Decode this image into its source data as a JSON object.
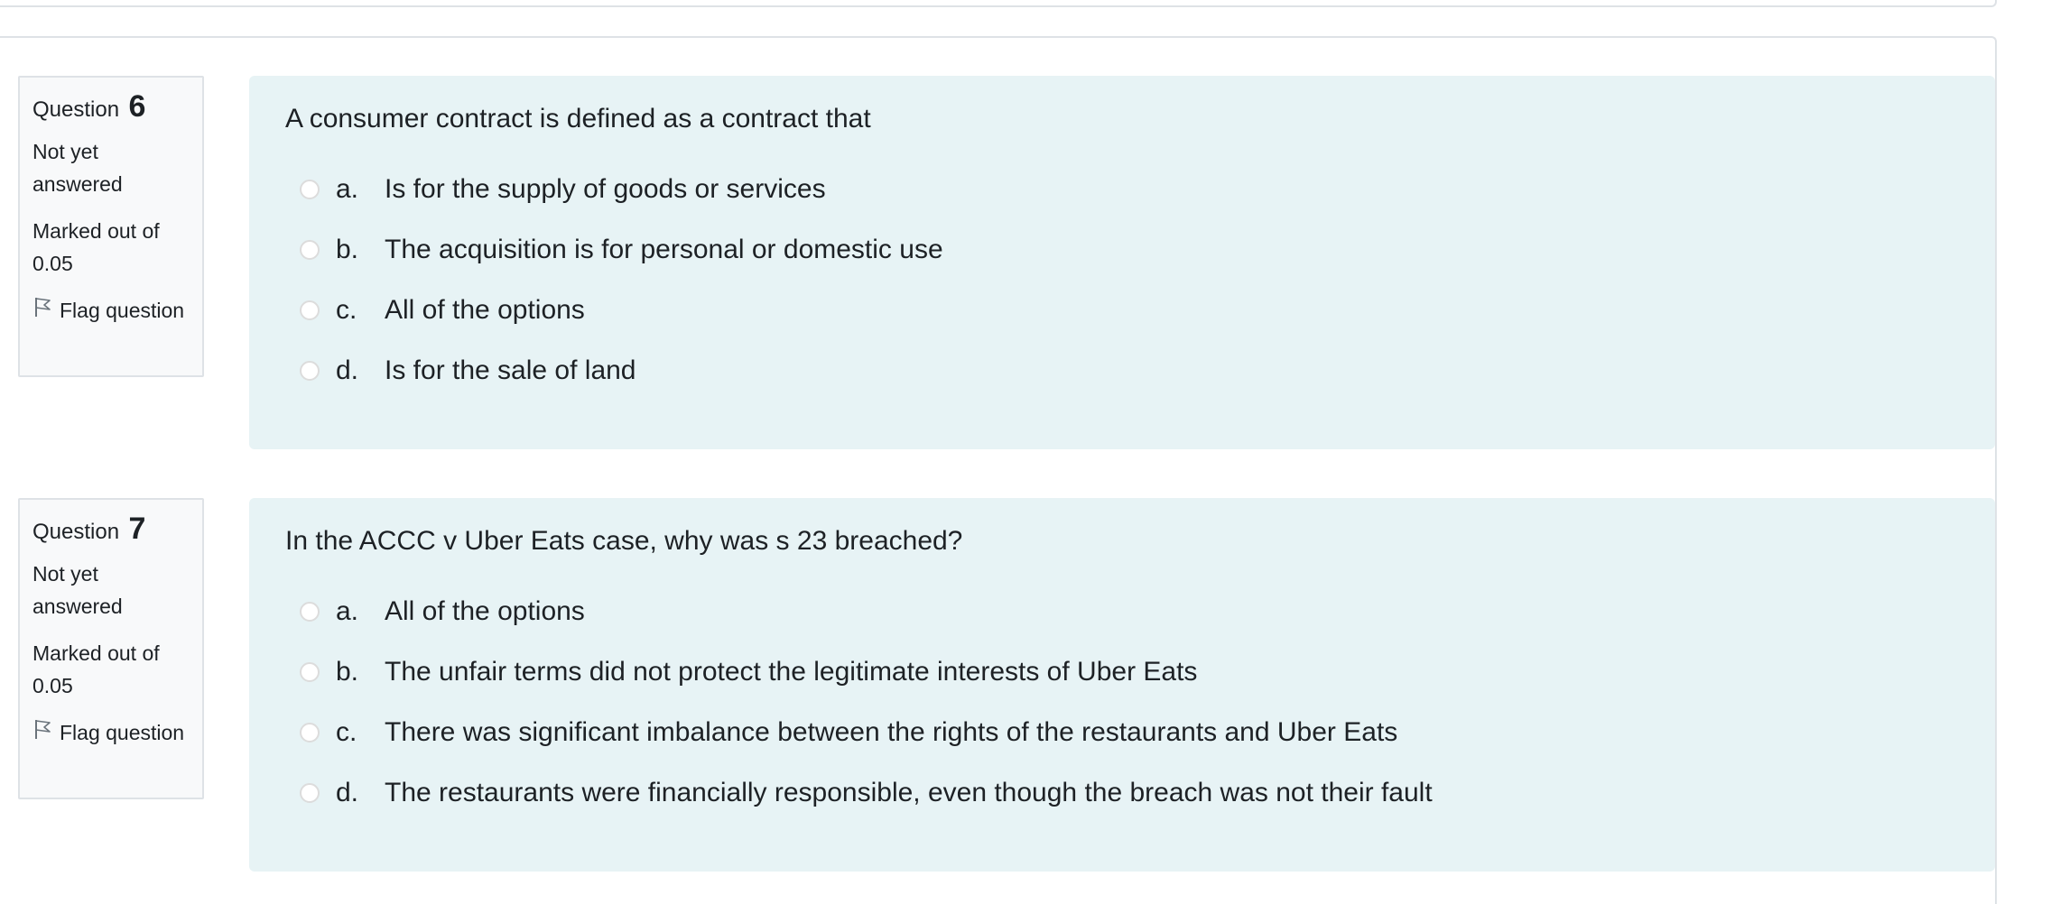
{
  "questions": [
    {
      "label": "Question",
      "number": "6",
      "state": "Not yet answered",
      "grade": "Marked out of 0.05",
      "flag_label": "Flag question",
      "text": "A consumer contract is defined as a contract that",
      "answers": [
        {
          "letter": "a.",
          "text": "Is for the supply of goods or services"
        },
        {
          "letter": "b.",
          "text": "The acquisition is for personal or domestic use"
        },
        {
          "letter": "c.",
          "text": "All of the options"
        },
        {
          "letter": "d.",
          "text": "Is for the sale of land"
        }
      ]
    },
    {
      "label": "Question",
      "number": "7",
      "state": "Not yet answered",
      "grade": "Marked out of 0.05",
      "flag_label": "Flag question",
      "text": "In the ACCC v Uber Eats case, why was s 23 breached?",
      "answers": [
        {
          "letter": "a.",
          "text": "All of the options"
        },
        {
          "letter": "b.",
          "text": "The unfair terms did not protect the legitimate interests of Uber Eats"
        },
        {
          "letter": "c.",
          "text": "There was significant imbalance between the rights of the restaurants and Uber Eats"
        },
        {
          "letter": "d.",
          "text": "The restaurants were financially responsible, even though the breach was not their fault"
        }
      ]
    }
  ],
  "colors": {
    "question_bg": "#e7f3f5",
    "info_bg": "#f8f9fa",
    "border": "#dee2e6"
  },
  "icons": {
    "flag": "flag-icon",
    "radio": "radio-empty-icon"
  }
}
